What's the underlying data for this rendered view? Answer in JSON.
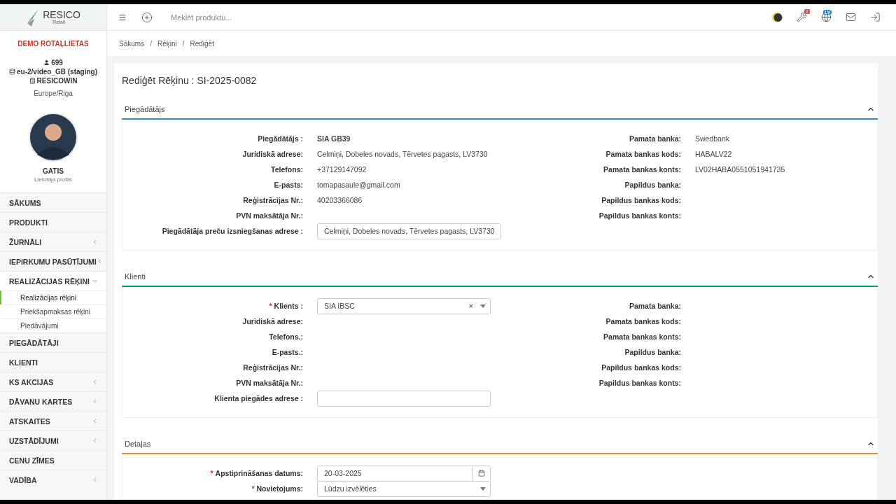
{
  "header": {
    "logo": {
      "name": "RESICO",
      "sub": "Retail"
    },
    "search": {
      "placeholder": "Meklēt produktu..."
    },
    "notification_badge": "1",
    "language": "LV"
  },
  "sidebar": {
    "company": "DEMO ROTAĻLIETAS",
    "user_count": "699",
    "database": "eu-2/video_GB (staging)",
    "register": "RESICOWIN",
    "timezone": "Europe/Riga",
    "user": {
      "name": "GATIS",
      "role": "Lietotāja profils"
    },
    "menu": [
      {
        "label": "SĀKUMS",
        "expandable": false
      },
      {
        "label": "PRODUKTI",
        "expandable": false
      },
      {
        "label": "ŽURNĀLI",
        "expandable": true,
        "expanded": false
      },
      {
        "label": "IEPIRKUMU PASŪTĪJUMI",
        "expandable": true,
        "expanded": false
      },
      {
        "label": "REALIZĀCIJAS RĒĶINI",
        "expandable": true,
        "expanded": true,
        "children": [
          {
            "label": "Realizācijas rēķini",
            "selected": true
          },
          {
            "label": "Priekšapmaksas rēķini",
            "selected": false
          },
          {
            "label": "Piedāvājumi",
            "selected": false
          }
        ]
      },
      {
        "label": "PIEGĀDĀTĀJI",
        "expandable": false
      },
      {
        "label": "KLIENTI",
        "expandable": false
      },
      {
        "label": "KS AKCIJAS",
        "expandable": true,
        "expanded": false
      },
      {
        "label": "DĀVANU KARTES",
        "expandable": true,
        "expanded": false
      },
      {
        "label": "ATSKAITES",
        "expandable": true,
        "expanded": false
      },
      {
        "label": "UZSTĀDĪJUMI",
        "expandable": true,
        "expanded": false
      },
      {
        "label": "CENU ZĪMES",
        "expandable": false
      },
      {
        "label": "VADĪBA",
        "expandable": true,
        "expanded": false
      }
    ]
  },
  "breadcrumb": {
    "separator": "/",
    "items": [
      "Sākums",
      "Rēķini",
      "Rediģēt"
    ]
  },
  "title": "Rediģēt Rēķinu : SI-2025-0082",
  "sections": [
    {
      "title": "Piegādātājs",
      "color": "#3c8dbc",
      "expanded": true,
      "left_fields": [
        {
          "kind": "bold",
          "label": "Piegādātājs :",
          "value": "SIA GB39"
        },
        {
          "kind": "text",
          "label": "Juridiskā adrese:",
          "value": "Celmiņi, Dobeles novads, Tērvetes pagasts, LV3730"
        },
        {
          "kind": "text",
          "label": "Telefons:",
          "value": "+37129147092"
        },
        {
          "kind": "text",
          "label": "E-pasts:",
          "value": "tomapasaule@gmail.com"
        },
        {
          "kind": "text",
          "label": "Reģistrācijas Nr.:",
          "value": "40203366086"
        },
        {
          "kind": "text",
          "label": "PVN maksātāja Nr.:"
        },
        {
          "kind": "input",
          "label": "Piegādātāja preču izsniegšanas adrese :",
          "value": "Celmiņi, Dobeles novads, Tērvetes pagasts, LV3730"
        }
      ],
      "right_fields": [
        {
          "kind": "text",
          "label": "Pamata banka:",
          "value": "Swedbank"
        },
        {
          "kind": "text",
          "label": "Pamata bankas kods:",
          "value": "HABALV22"
        },
        {
          "kind": "text",
          "label": "Pamata bankas konts:",
          "value": "LV02HABA0551051941735"
        },
        {
          "kind": "text",
          "label": "Papildus banka:"
        },
        {
          "kind": "text",
          "label": "Papildus bankas kods:"
        },
        {
          "kind": "text",
          "label": "Papildus bankas konts:"
        }
      ]
    },
    {
      "title": "Klienti",
      "color": "#00a65a",
      "expanded": true,
      "left_fields": [
        {
          "kind": "select",
          "required_mark": "*",
          "label": "Klients :",
          "value": "SIA IBSC",
          "clear": "×"
        },
        {
          "kind": "text",
          "label": "Juridiskā adrese:"
        },
        {
          "kind": "text",
          "label": "Telefons.:"
        },
        {
          "kind": "text",
          "label": "E-pasts.:"
        },
        {
          "kind": "text",
          "label": "Reģistrācijas Nr.:"
        },
        {
          "kind": "text",
          "label": "PVN maksātāja Nr.:"
        },
        {
          "kind": "input",
          "label": "Klienta piegādes adrese :"
        }
      ],
      "right_fields": [
        {
          "kind": "text",
          "label": "Pamata banka:"
        },
        {
          "kind": "text",
          "label": "Pamata bankas kods:"
        },
        {
          "kind": "text",
          "label": "Pamata bankas konts:"
        },
        {
          "kind": "text",
          "label": "Papildus banka:"
        },
        {
          "kind": "text",
          "label": "Papildus bankas kods:"
        },
        {
          "kind": "text",
          "label": "Papildus bankas konts:"
        }
      ]
    },
    {
      "title": "Detaļas",
      "color": "#e08e3b",
      "expanded": true,
      "left_fields": [
        {
          "kind": "date",
          "required_mark": "*",
          "label": "Apstiprināšanas datums:",
          "value": "20-03-2025"
        },
        {
          "kind": "select",
          "required_mark": "*",
          "label": "Novietojums:",
          "value": "Lūdzu izvēlēties"
        }
      ]
    }
  ]
}
